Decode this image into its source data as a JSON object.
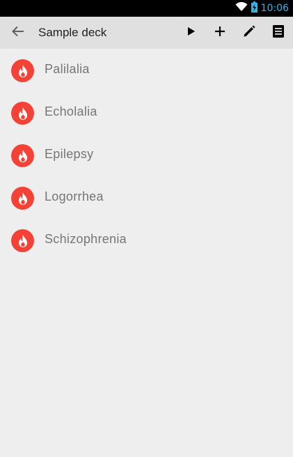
{
  "status_bar": {
    "time": "10:06",
    "icons": [
      "wifi-icon",
      "battery-icon"
    ],
    "time_color": "#33b5e5"
  },
  "app_bar": {
    "title": "Sample deck",
    "back_icon": "arrow-back-icon",
    "actions": [
      {
        "name": "play-button",
        "icon": "play-icon"
      },
      {
        "name": "add-button",
        "icon": "plus-icon"
      },
      {
        "name": "edit-button",
        "icon": "pencil-icon"
      },
      {
        "name": "list-button",
        "icon": "list-icon"
      }
    ]
  },
  "cards": [
    {
      "label": "Palilalia",
      "icon": "flame-icon"
    },
    {
      "label": "Echolalia",
      "icon": "flame-icon"
    },
    {
      "label": "Epilepsy",
      "icon": "flame-icon"
    },
    {
      "label": "Logorrhea",
      "icon": "flame-icon"
    },
    {
      "label": "Schizophrenia",
      "icon": "flame-icon"
    }
  ],
  "colors": {
    "accent": "#f44336",
    "app_bar": "#e0e0e0",
    "background": "#eeeeee"
  }
}
